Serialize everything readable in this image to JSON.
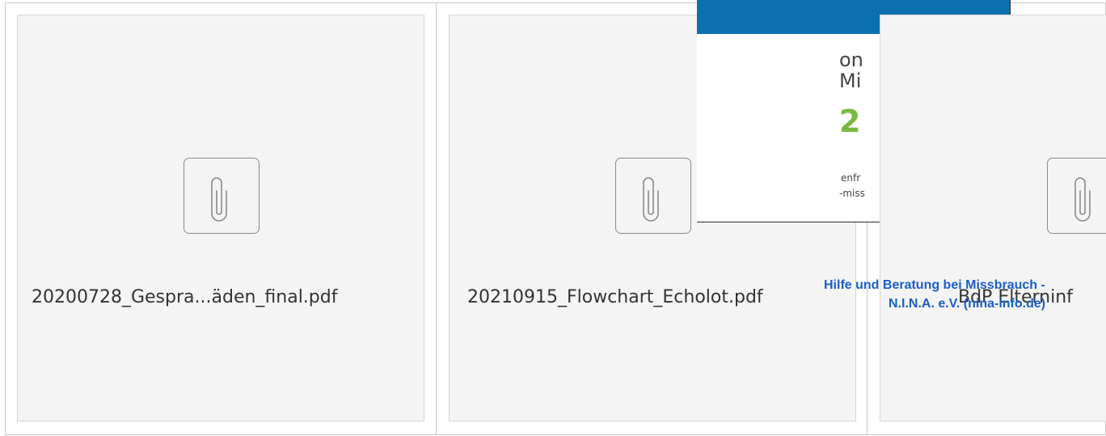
{
  "attachments": [
    {
      "filename": "20200728_Gespra...äden_final.pdf",
      "icon": "paperclip-icon"
    },
    {
      "filename": "20210915_Flowchart_Echolot.pdf",
      "icon": "paperclip-icon"
    },
    {
      "filename": "BdP Elterninf",
      "icon": "paperclip-icon"
    }
  ],
  "banner": {
    "line1": "on",
    "line2": "Mi",
    "number": "2",
    "small1": "enfr",
    "small2": "-miss",
    "accent_color": "#0b6fb0",
    "number_color": "#7ab940"
  },
  "link": {
    "line1": "Hilfe und Beratung bei Missbrauch -",
    "line2": "N.I.N.A. e.V. (nina-info.de)",
    "color": "#1a5fc8"
  }
}
